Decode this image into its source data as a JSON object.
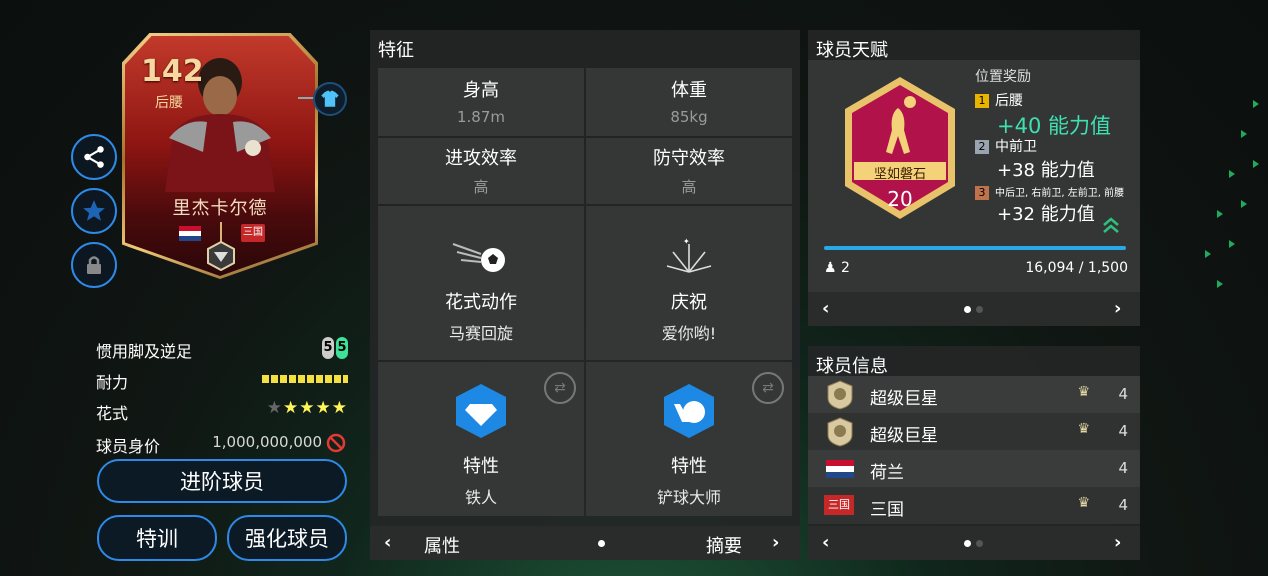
{
  "card": {
    "rating": "142",
    "position": "后腰",
    "name": "里杰卡尔德",
    "club_badge": "三国"
  },
  "left_stats": [
    {
      "label": "惯用脚及逆足",
      "foot_left": "5",
      "foot_right": "5"
    },
    {
      "label": "耐力"
    },
    {
      "label": "花式",
      "stars": "★★★★",
      "dim_star": "★"
    },
    {
      "label": "球员身价",
      "value": "1,000,000,000"
    }
  ],
  "buttons": {
    "advance": "进阶球员",
    "train": "特训",
    "enhance": "强化球员"
  },
  "features": {
    "title": "特征",
    "height_label": "身高",
    "height_value": "1.87m",
    "weight_label": "体重",
    "weight_value": "85kg",
    "attack_label": "进攻效率",
    "attack_value": "高",
    "defense_label": "防守效率",
    "defense_value": "高",
    "skill_label": "花式动作",
    "skill_value": "马赛回旋",
    "celebration_label": "庆祝",
    "celebration_value": "爱你哟!",
    "trait1_label": "特性",
    "trait1_value": "铁人",
    "trait2_label": "特性",
    "trait2_value": "铲球大师",
    "nav_left": "属性",
    "nav_right": "摘要"
  },
  "talent": {
    "title": "球员天赋",
    "badge_name": "坚如磐石",
    "badge_level": "20",
    "reward_title": "位置奖励",
    "rewards": [
      {
        "rank": "1",
        "pos": "后腰",
        "boost": "+40 能力值",
        "color": "#e8b400"
      },
      {
        "rank": "2",
        "pos": "中前卫",
        "boost": "+38 能力值",
        "color": "#9aa3b0"
      },
      {
        "rank": "3",
        "pos": "中后卫, 右前卫, 左前卫, 前腰",
        "boost": "+32 能力值",
        "color": "#c0724a"
      }
    ],
    "progress_count": "2",
    "progress_text": "16,094 / 1,500"
  },
  "player_info": {
    "title": "球员信息",
    "rows": [
      {
        "name": "超级巨星",
        "level": "4"
      },
      {
        "name": "超级巨星",
        "level": "4"
      },
      {
        "name": "荷兰",
        "level": "4"
      },
      {
        "name": "三国",
        "level": "4"
      }
    ]
  },
  "colors": {
    "accent": "#2e8ae6",
    "boost_green": "#3fe0b0",
    "stamina": "#f5e042"
  }
}
